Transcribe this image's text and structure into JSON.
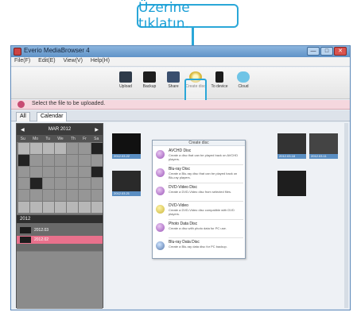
{
  "callout": {
    "text": "Üzerine tıklatın."
  },
  "colors": {
    "callout_border": "#2aa7d8",
    "selected_row": "#e8718c",
    "info_bar": "#f5d7de"
  },
  "window": {
    "title": "Everio MediaBrowser 4",
    "buttons": {
      "minimize": "—",
      "maximize": "□",
      "close": "✕"
    }
  },
  "menu": [
    "File(F)",
    "Edit(E)",
    "View(V)",
    "Help(H)"
  ],
  "toolbar": {
    "items": [
      {
        "label": "Upload",
        "icon": "film-icon"
      },
      {
        "label": "Backup",
        "icon": "monitor-icon"
      },
      {
        "label": "Share",
        "icon": "share-icon"
      },
      {
        "label": "Create disc",
        "icon": "disc-icon"
      },
      {
        "label": "To device",
        "icon": "phone-icon"
      },
      {
        "label": "Cloud",
        "icon": "cloud-icon"
      }
    ]
  },
  "infobar": {
    "text": "Select the file to be uploaded."
  },
  "tabs": [
    "All",
    "Calendar"
  ],
  "calendar": {
    "month": "MAR 2012",
    "days": [
      "Su",
      "Mo",
      "Tu",
      "We",
      "Th",
      "Fr",
      "Sa"
    ]
  },
  "year": {
    "label": "2012",
    "rows": [
      "2012.03",
      "2012.02"
    ]
  },
  "dropdown": {
    "header": "Create disc",
    "items": [
      {
        "title": "AVCHD Disc",
        "desc": "Create a disc that can be played back on AVCHD players.",
        "icon": "disc-icon"
      },
      {
        "title": "Blu-ray Disc",
        "desc": "Create a Blu-ray disc that can be played back on Blu-ray players.",
        "icon": "disc-icon"
      },
      {
        "title": "DVD-Video Disc",
        "desc": "Create a DVD-Video disc from selected files.",
        "icon": "disc-icon"
      },
      {
        "title": "DVD-Video",
        "desc": "Create a DVD-Video disc compatible with DVD players.",
        "icon": "dvd-icon"
      },
      {
        "title": "Photo Data Disc",
        "desc": "Create a disc with photo data for PC use.",
        "icon": "disc-icon"
      },
      {
        "title": "Blu-ray Data Disc",
        "desc": "Create a Blu-ray data disc for PC backup.",
        "icon": "disc-icon"
      }
    ]
  },
  "photos": [
    "2012.03.22",
    "2012.03.21",
    "2012.03.18",
    "2012.03.11"
  ]
}
